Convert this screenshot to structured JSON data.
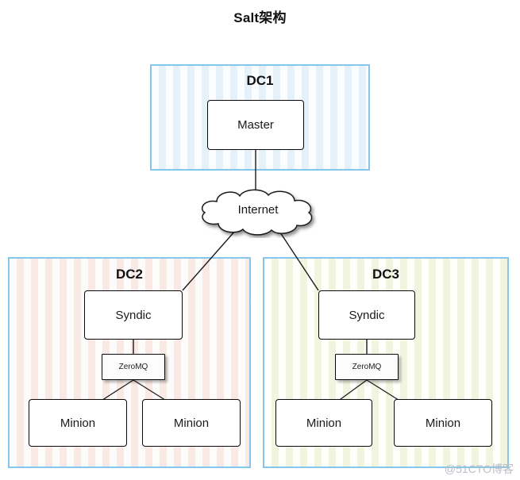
{
  "title": "Salt架构",
  "watermark": "@51CTO博客",
  "colors": {
    "container_border": "#85c7ec",
    "node_border": "#0a0a0a",
    "dc1_fill": "#f2f8fc",
    "dc2_fill": "#fdf4f2",
    "dc3_fill": "#fafbf0",
    "connector": "#1a1a1a",
    "watermark": "#b9bfc6"
  },
  "cloud": {
    "label": "Internet",
    "icon": "cloud-icon"
  },
  "containers": [
    {
      "id": "dc1",
      "label": "DC1",
      "nodes": [
        {
          "id": "master",
          "label": "Master",
          "type": "service"
        }
      ]
    },
    {
      "id": "dc2",
      "label": "DC2",
      "nodes": [
        {
          "id": "syndic",
          "label": "Syndic",
          "type": "service"
        },
        {
          "id": "zeromq",
          "label": "ZeroMQ",
          "type": "bus"
        },
        {
          "id": "minion_a",
          "label": "Minion",
          "type": "agent"
        },
        {
          "id": "minion_b",
          "label": "Minion",
          "type": "agent"
        }
      ]
    },
    {
      "id": "dc3",
      "label": "DC3",
      "nodes": [
        {
          "id": "syndic",
          "label": "Syndic",
          "type": "service"
        },
        {
          "id": "zeromq",
          "label": "ZeroMQ",
          "type": "bus"
        },
        {
          "id": "minion_a",
          "label": "Minion",
          "type": "agent"
        },
        {
          "id": "minion_b",
          "label": "Minion",
          "type": "agent"
        }
      ]
    }
  ],
  "edges": [
    {
      "from": "master",
      "to": "internet"
    },
    {
      "from": "internet",
      "to": "dc2.syndic"
    },
    {
      "from": "internet",
      "to": "dc3.syndic"
    },
    {
      "from": "dc2.syndic",
      "to": "dc2.zeromq"
    },
    {
      "from": "dc2.zeromq",
      "to": "dc2.minion_a"
    },
    {
      "from": "dc2.zeromq",
      "to": "dc2.minion_b"
    },
    {
      "from": "dc3.syndic",
      "to": "dc3.zeromq"
    },
    {
      "from": "dc3.zeromq",
      "to": "dc3.minion_a"
    },
    {
      "from": "dc3.zeromq",
      "to": "dc3.minion_b"
    }
  ]
}
